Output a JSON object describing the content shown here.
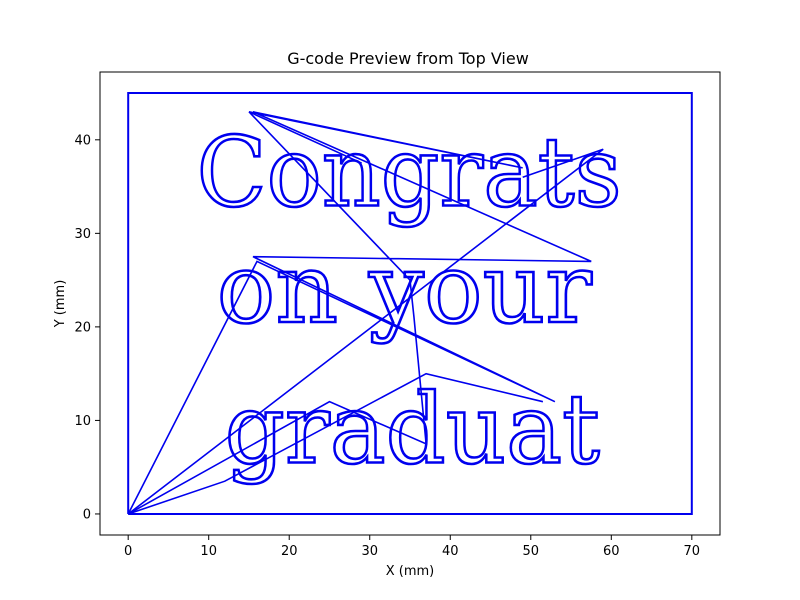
{
  "chart_data": {
    "type": "line",
    "title": "G-code Preview from Top View",
    "xlabel": "X (mm)",
    "ylabel": "Y (mm)",
    "xlim": [
      -3.5,
      73.5
    ],
    "ylim": [
      -2.25,
      47.25
    ],
    "xticks": [
      0,
      10,
      20,
      30,
      40,
      50,
      60,
      70
    ],
    "yticks": [
      0,
      10,
      20,
      30,
      40
    ],
    "grid": false,
    "line_color": "#0000ee",
    "series": [
      {
        "values_role": "border",
        "points": [
          [
            0,
            0
          ],
          [
            70,
            0
          ],
          [
            70,
            45
          ],
          [
            0,
            45
          ],
          [
            0,
            0
          ]
        ]
      },
      {
        "values_role": "travel",
        "points": [
          [
            0,
            0
          ],
          [
            16,
            27
          ],
          [
            53,
            12
          ],
          [
            15.5,
            27.5
          ],
          [
            57.5,
            27
          ],
          [
            15.5,
            43
          ],
          [
            49,
            37
          ],
          [
            15,
            43
          ],
          [
            29,
            37.5
          ],
          [
            15,
            43
          ],
          [
            35,
            25
          ]
        ]
      },
      {
        "values_role": "travel",
        "points": [
          [
            0,
            0
          ],
          [
            59,
            39
          ],
          [
            49,
            36
          ]
        ]
      },
      {
        "values_role": "travel",
        "points": [
          [
            0,
            0
          ],
          [
            25,
            12
          ],
          [
            37,
            7.5
          ],
          [
            35.5,
            21
          ],
          [
            35,
            25
          ]
        ]
      },
      {
        "values_role": "travel",
        "points": [
          [
            0,
            0
          ],
          [
            12,
            3.5
          ],
          [
            37,
            15
          ],
          [
            51.5,
            12
          ]
        ]
      }
    ],
    "text_paths": [
      {
        "text": "Congrats",
        "x": 8.5,
        "y": 33
      },
      {
        "text": "on your",
        "x": 11,
        "y": 20.5
      },
      {
        "text": "graduat",
        "x": 12,
        "y": 5.5
      }
    ]
  }
}
